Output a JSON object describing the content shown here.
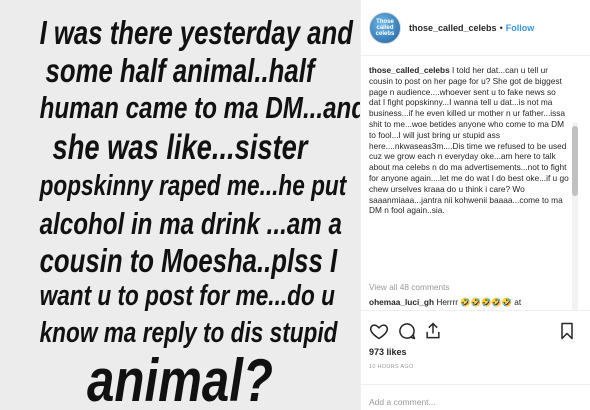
{
  "post_image": {
    "lines": [
      "I was there yesterday and",
      "some half animal..half",
      "human came to ma DM...and",
      "she was like...sister",
      "popskinny raped me...he put",
      "alcohol in ma drink ...am a",
      "cousin to Moesha..plss I",
      "want u to post for me...do u",
      "know ma reply to dis stupid",
      "animal?"
    ]
  },
  "header": {
    "avatar_text": "Those called celebs",
    "username": "those_called_celebs",
    "separator": "•",
    "follow_label": "Follow"
  },
  "caption": {
    "username": "those_called_celebs",
    "text": "I told her dat...can u tell ur cousin to post on her page for u? She got de biggest page n audience....whoever sent u to fake news so dat I fight popskinny...I wanna tell u dat...is not ma business...if he even killed ur mother n ur father...issa shit to me...woe betides anyone who come to ma DM to fool...I will just bring ur stupid ass here....nkwaseas3m....Dis time we refused to be used cuz we grow each n everyday oke...am here to talk about ma celebs n do ma advertisements...not to fight for anyone again....let me do wat I do best oke...if u go chew urselves kraaa do u think i care? Wo saaanmiaaa...jantra nii kohwenii baaaa...come to ma DM n fool again..sia."
  },
  "comments": {
    "view_all_label": "View all 48 comments",
    "first_comment": {
      "username": "ohemaa_luci_gh",
      "text": "Herrrr 🤣🤣🤣🤣🤣 at"
    }
  },
  "stats": {
    "likes": "973 likes",
    "timestamp": "10 HOURS AGO"
  },
  "add_comment": {
    "placeholder": "Add a comment..."
  },
  "icons": {
    "like": "heart-icon",
    "comment": "comment-icon",
    "share": "share-icon",
    "save": "bookmark-icon"
  }
}
